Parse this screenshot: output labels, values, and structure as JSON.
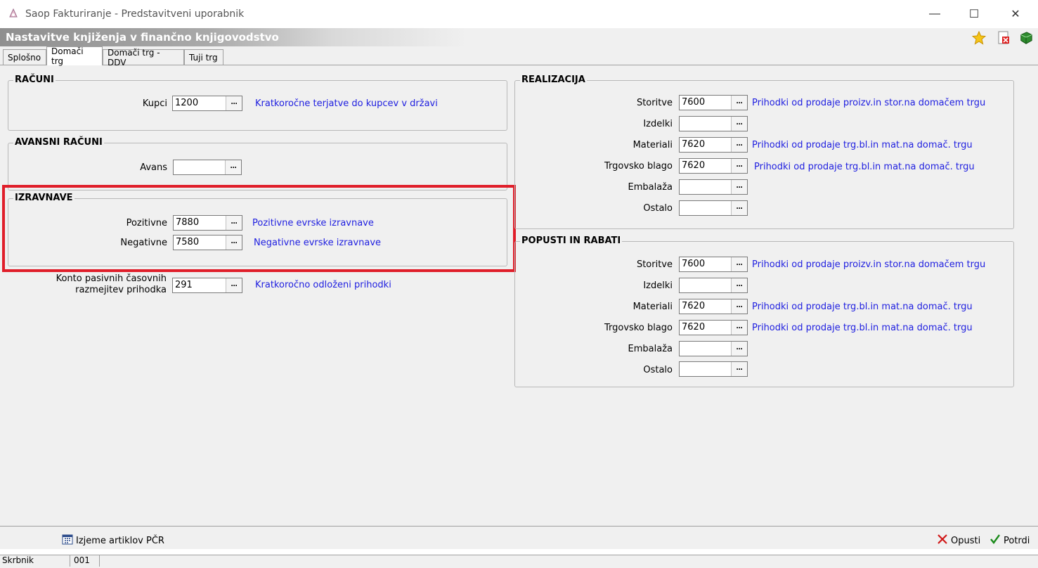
{
  "window": {
    "title": "Saop Fakturiranje - Predstavitveni uporabnik",
    "minimize": "—",
    "maximize": "☐",
    "close": "✕"
  },
  "header": {
    "title": "Nastavitve knjiženja v finančno knjigovodstvo",
    "icons": [
      "star-icon",
      "delete-icon",
      "book-icon"
    ]
  },
  "tabs": [
    {
      "label": "Splošno",
      "active": false
    },
    {
      "label": "Domači trg",
      "active": true
    },
    {
      "label": "Domači trg - DDV",
      "active": false
    },
    {
      "label": "Tuji trg",
      "active": false
    }
  ],
  "racuni": {
    "title": "RAČUNI",
    "kupci": {
      "label": "Kupci",
      "value": "1200",
      "desc": "Kratkoročne terjatve do kupcev v državi"
    }
  },
  "avansni": {
    "title": "AVANSNI RAČUNI",
    "avans": {
      "label": "Avans",
      "value": "",
      "desc": ""
    }
  },
  "izravnave": {
    "title": "IZRAVNAVE",
    "pozitivne": {
      "label": "Pozitivne",
      "value": "7880",
      "desc": "Pozitivne evrske izravnave"
    },
    "negativne": {
      "label": "Negativne",
      "value": "7580",
      "desc": "Negativne evrske izravnave"
    }
  },
  "pasivne": {
    "label_line1": "Konto pasivnih časovnih",
    "label_line2": "razmejitev prihodka",
    "value": "291",
    "desc": "Kratkoročno odloženi prihodki"
  },
  "realizacija": {
    "title": "REALIZACIJA",
    "rows": [
      {
        "label": "Storitve",
        "value": "7600",
        "desc": "Prihodki od prodaje proizv.in stor.na domačem trgu"
      },
      {
        "label": "Izdelki",
        "value": "",
        "desc": ""
      },
      {
        "label": "Materiali",
        "value": "7620",
        "desc": "Prihodki od prodaje trg.bl.in mat.na domač. trgu"
      },
      {
        "label": "Trgovsko blago",
        "value": "7620",
        "desc": "Prihodki od prodaje trg.bl.in mat.na domač. trgu"
      },
      {
        "label": "Embalaža",
        "value": "",
        "desc": ""
      },
      {
        "label": "Ostalo",
        "value": "",
        "desc": ""
      }
    ]
  },
  "popusti": {
    "title": "POPUSTI IN RABATI",
    "rows": [
      {
        "label": "Storitve",
        "value": "7600",
        "desc": "Prihodki od prodaje proizv.in stor.na domačem trgu"
      },
      {
        "label": "Izdelki",
        "value": "",
        "desc": ""
      },
      {
        "label": "Materiali",
        "value": "7620",
        "desc": "Prihodki od prodaje trg.bl.in mat.na domač. trgu"
      },
      {
        "label": "Trgovsko blago",
        "value": "7620",
        "desc": "Prihodki od prodaje trg.bl.in mat.na domač. trgu"
      },
      {
        "label": "Embalaža",
        "value": "",
        "desc": ""
      },
      {
        "label": "Ostalo",
        "value": "",
        "desc": ""
      }
    ]
  },
  "lookup_button": "···",
  "bottom": {
    "izjeme_label": "Izjeme artiklov PČR",
    "opusti_label": "Opusti",
    "potrdi_label": "Potrdi"
  },
  "status": {
    "user": "Skrbnik",
    "code": "001"
  },
  "colors": {
    "highlight": "#e01e2a",
    "link_text": "#2020e0"
  }
}
